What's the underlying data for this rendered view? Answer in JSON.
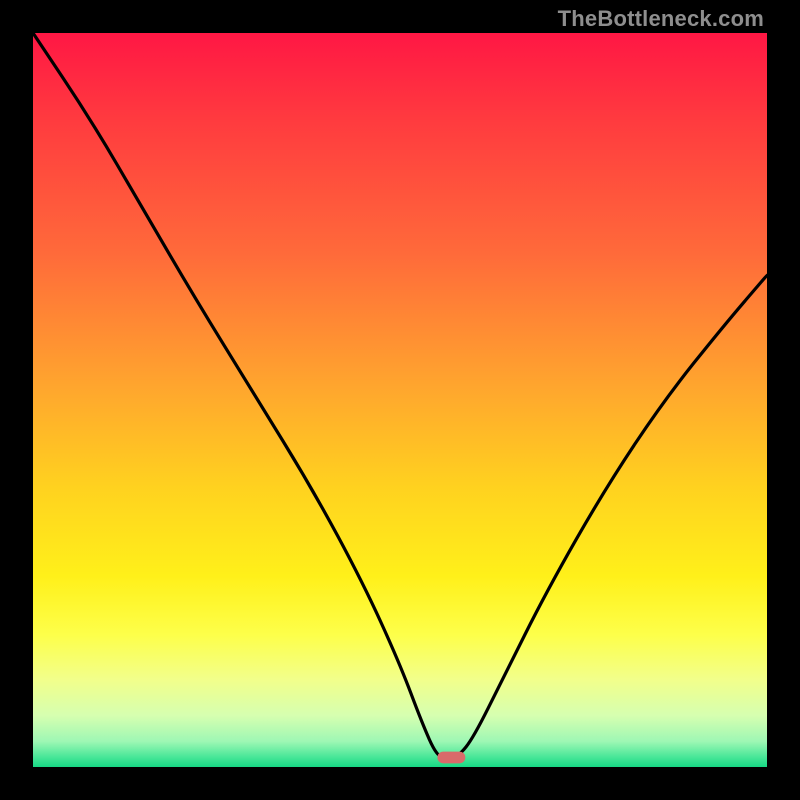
{
  "watermark": "TheBottleneck.com",
  "chart_data": {
    "type": "line",
    "title": "",
    "xlabel": "",
    "ylabel": "",
    "xlim": [
      0,
      100
    ],
    "ylim": [
      0,
      100
    ],
    "grid": false,
    "legend": false,
    "series": [
      {
        "name": "bottleneck-curve",
        "x": [
          0,
          8,
          15,
          22,
          30,
          38,
          45,
          50,
          53,
          55,
          56.5,
          58,
          60,
          64,
          70,
          78,
          86,
          94,
          100
        ],
        "y": [
          100,
          88,
          76,
          64,
          51,
          38,
          25,
          14,
          6,
          1.5,
          1.2,
          1.5,
          4,
          12,
          24,
          38,
          50,
          60,
          67
        ]
      }
    ],
    "marker": {
      "name": "optimum-pill",
      "x_center": 57,
      "y_center": 1.3,
      "width": 3.8,
      "height": 1.6,
      "color": "#d96a6a"
    },
    "background_gradient": {
      "stops": [
        {
          "offset": 0.0,
          "color": "#ff1744"
        },
        {
          "offset": 0.12,
          "color": "#ff3b3f"
        },
        {
          "offset": 0.3,
          "color": "#ff6a3a"
        },
        {
          "offset": 0.48,
          "color": "#ffa52e"
        },
        {
          "offset": 0.62,
          "color": "#ffd21f"
        },
        {
          "offset": 0.74,
          "color": "#fff01a"
        },
        {
          "offset": 0.82,
          "color": "#fdff4a"
        },
        {
          "offset": 0.88,
          "color": "#f2ff8a"
        },
        {
          "offset": 0.93,
          "color": "#d6ffb0"
        },
        {
          "offset": 0.965,
          "color": "#9ef7b4"
        },
        {
          "offset": 0.985,
          "color": "#4ee89a"
        },
        {
          "offset": 1.0,
          "color": "#17d884"
        }
      ]
    }
  }
}
